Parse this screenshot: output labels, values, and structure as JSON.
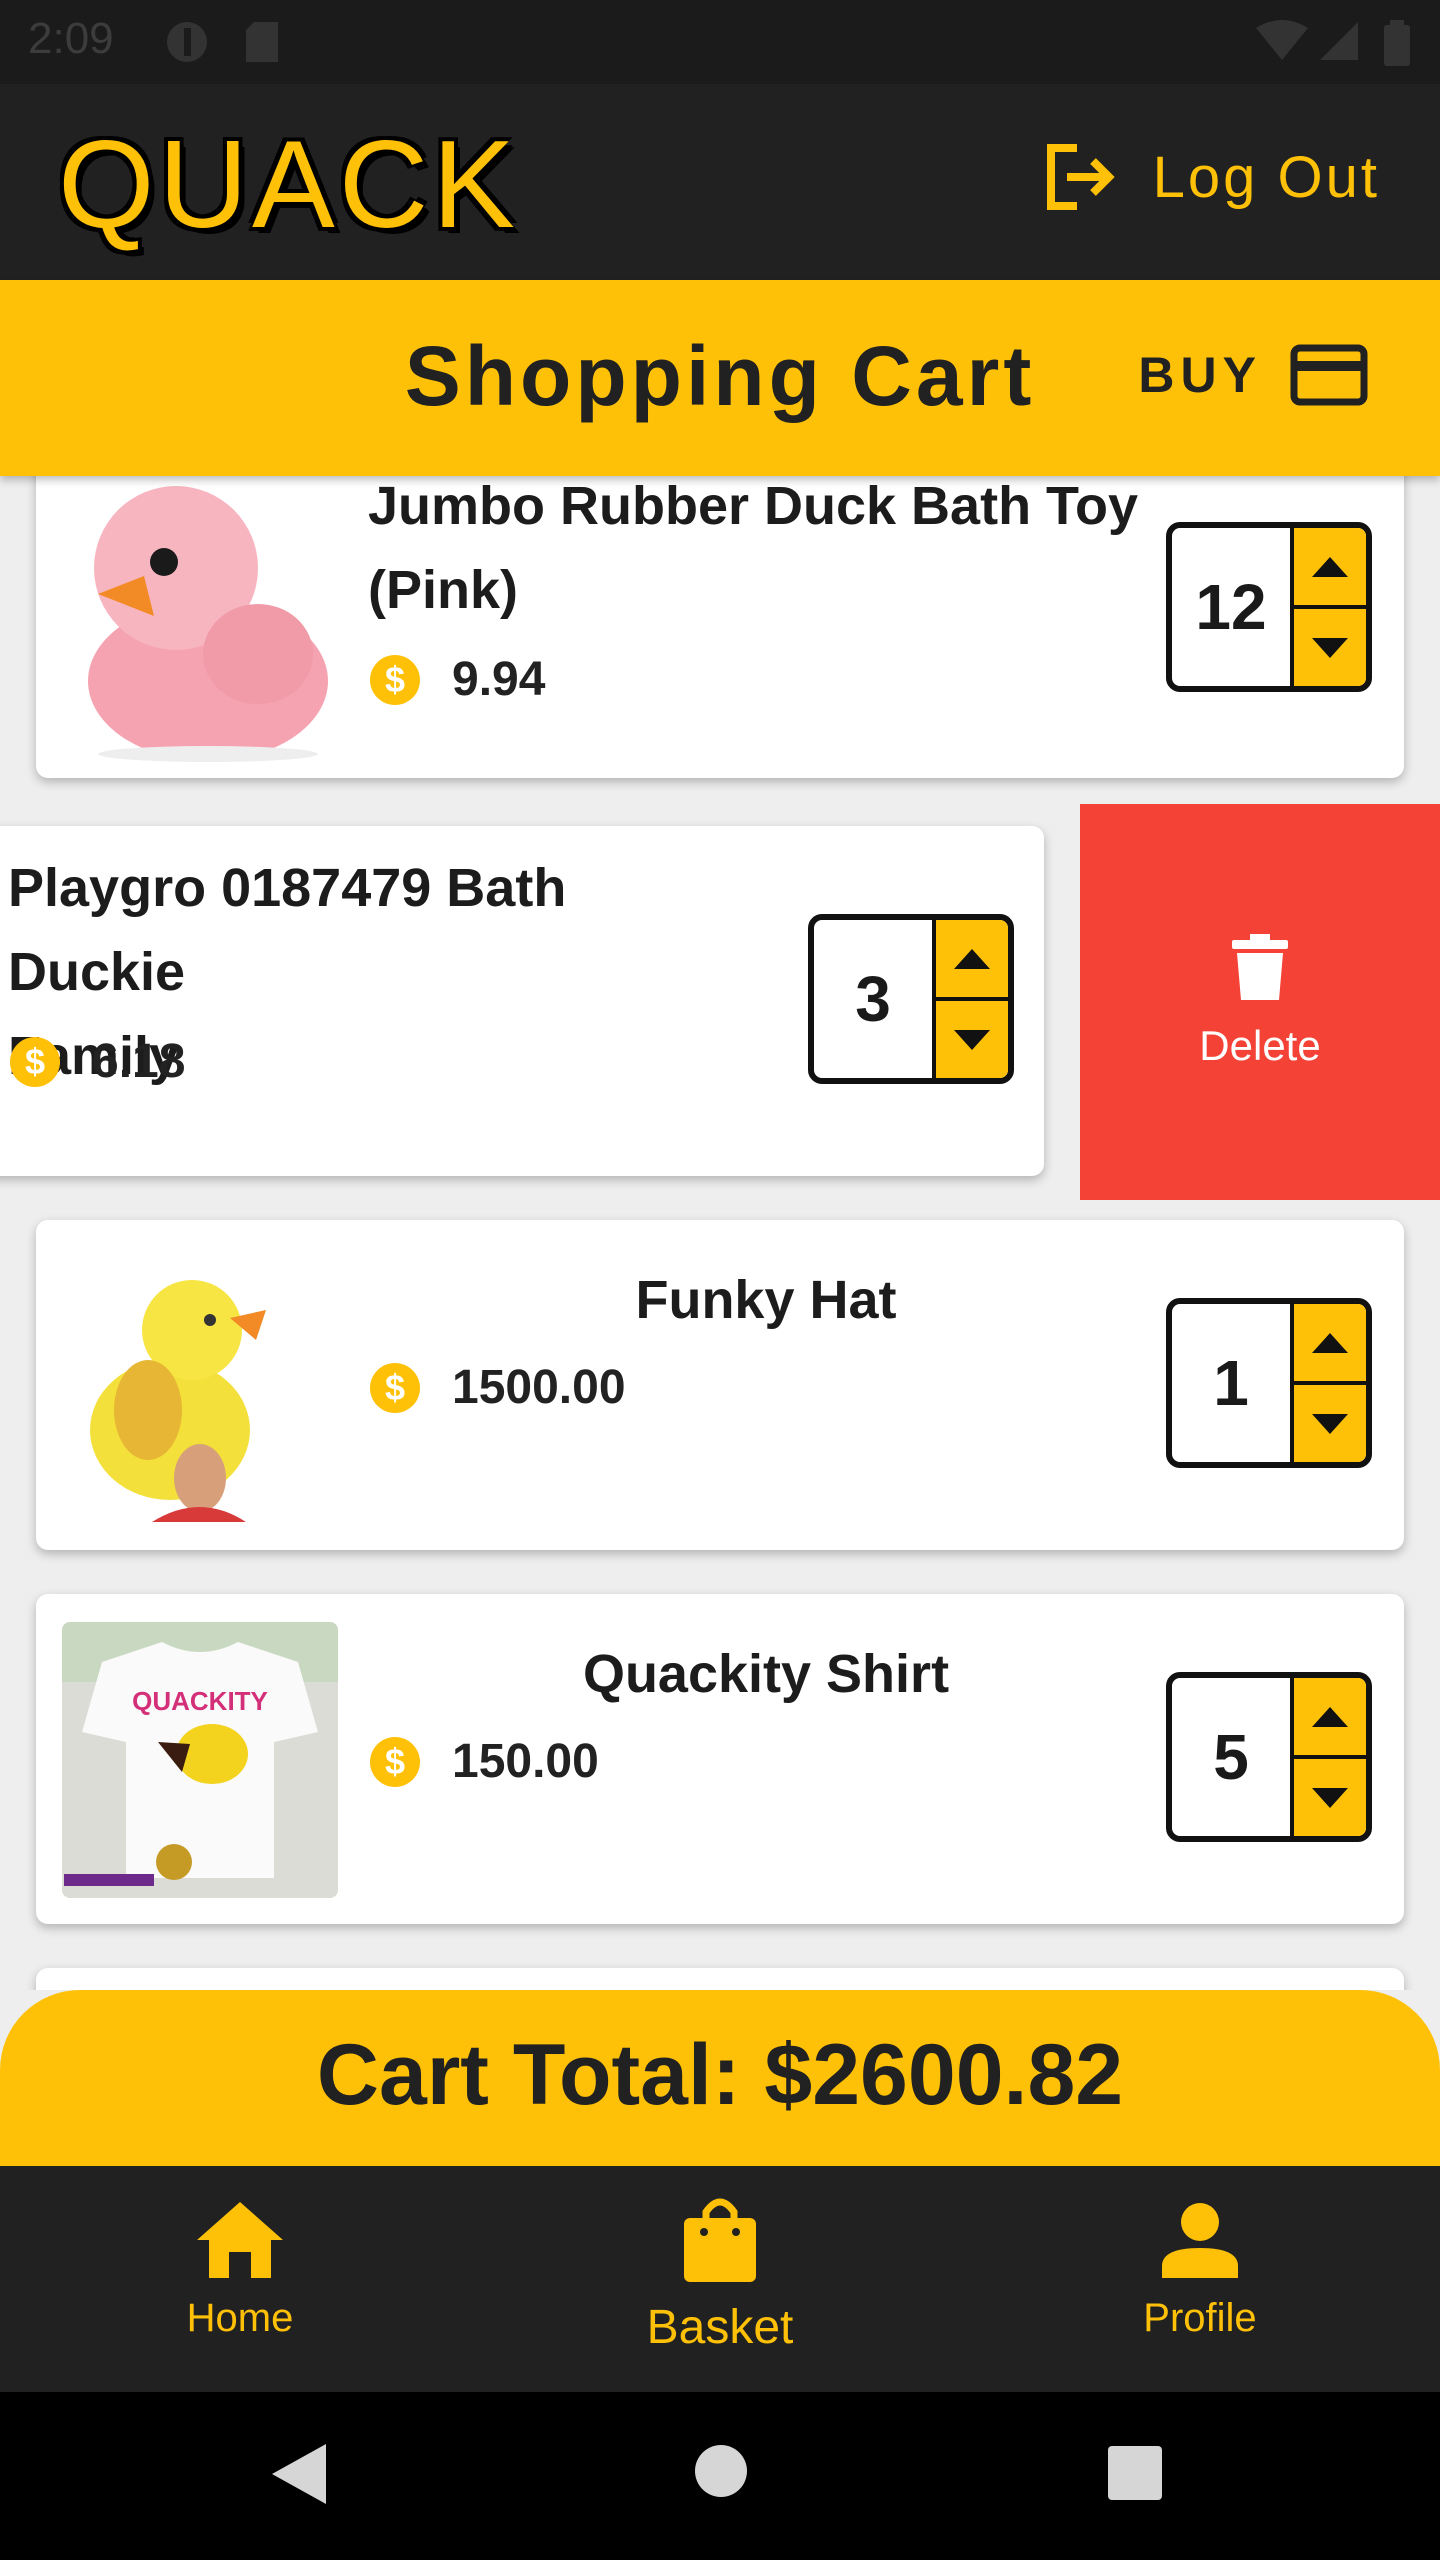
{
  "status_bar": {
    "time": "2:09"
  },
  "header": {
    "app_title": "QUACK",
    "logout_label": "Log Out"
  },
  "cart_header": {
    "title": "Shopping Cart",
    "buy_label": "BUY"
  },
  "cart_items": [
    {
      "name_line1": "Jumbo Rubber Duck Bath Toy",
      "name_line2": "(Pink)",
      "price": "9.94",
      "quantity": "12"
    },
    {
      "name_line1": "Playgro 0187479 Bath Duckie",
      "name_line2": "Family",
      "price": "6.18",
      "quantity": "3"
    },
    {
      "name": "Funky Hat",
      "price": "1500.00",
      "quantity": "1"
    },
    {
      "name": "Quackity Shirt",
      "price": "150.00",
      "quantity": "5"
    }
  ],
  "delete_action": {
    "label": "Delete"
  },
  "cart_total": {
    "text": "Cart Total: $2600.82"
  },
  "bottom_nav": {
    "home": "Home",
    "basket": "Basket",
    "profile": "Profile"
  },
  "colors": {
    "accent": "#ffc107",
    "dark": "#212121",
    "delete": "#f44336"
  },
  "icons": [
    "logout-icon",
    "credit-card-icon",
    "dollar-coin-icon",
    "chevron-up-icon",
    "chevron-down-icon",
    "trash-icon",
    "home-icon",
    "shopping-bag-icon",
    "person-icon",
    "back-icon",
    "home-circle-icon",
    "recents-icon"
  ]
}
